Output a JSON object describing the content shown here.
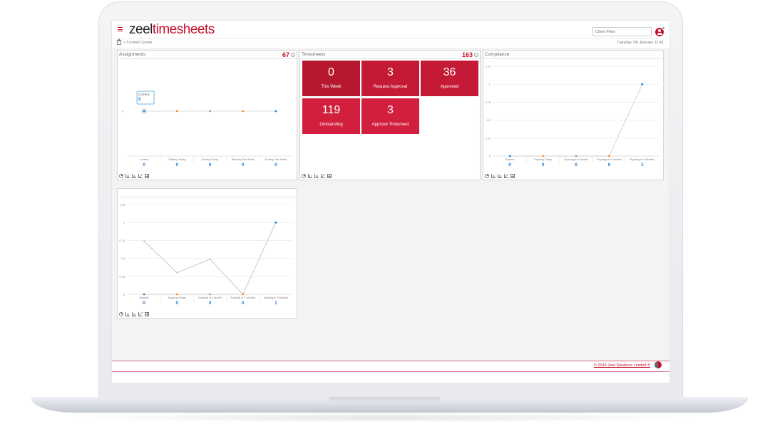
{
  "app": {
    "logo_part1": "zeel",
    "logo_part2": "timesheets",
    "client_filter_placeholder": "Client Filter",
    "breadcrumb": "» Control Centre",
    "datetime": "Tuesday 7th January 11:41",
    "copyright": "© 2016 Zeel Solutions Limited ®"
  },
  "colors": {
    "brand": "#c8102e",
    "tile_dark": "#b5182f",
    "tile": "#d11f3d",
    "blue": "#2a7bd0",
    "orange": "#f28c28"
  },
  "assignments": {
    "title": "Assignments",
    "count": "67",
    "tooltip_label": "Current",
    "tooltip_value": "0",
    "chart_data": {
      "type": "line",
      "categories": [
        "Current",
        "Starting Today",
        "Ending Today",
        "Starting This Week",
        "Ending This Week"
      ],
      "values": [
        0,
        0,
        0,
        0,
        0
      ],
      "point_colors": [
        "#2a7bd0",
        "#f28c28",
        "#999999",
        "#f28c28",
        "#2a7bd0"
      ],
      "ytick": "0",
      "value_labels": [
        "0",
        "0",
        "0",
        "0",
        "0"
      ]
    }
  },
  "timesheets": {
    "title": "Timesheets",
    "count": "163",
    "tiles": [
      {
        "value": "0",
        "label": "This Week"
      },
      {
        "value": "3",
        "label": "Request Approval"
      },
      {
        "value": "36",
        "label": "Approved"
      },
      {
        "value": "119",
        "label": "Outstanding"
      },
      {
        "value": "3",
        "label": "Approve Timesheet"
      }
    ]
  },
  "compliance": {
    "title": "Compliance",
    "chart_data": {
      "type": "line",
      "categories": [
        "Expired",
        "Expiring Today",
        "Expiring in 1 Month",
        "Expiring in 2 Months",
        "Expiring in 3 Months"
      ],
      "values": [
        0,
        0,
        0,
        0,
        1
      ],
      "ylim": [
        0,
        1.25
      ],
      "yticks": [
        "0",
        "0.25",
        "0.5",
        "0.75",
        "1",
        "1.25"
      ],
      "value_labels": [
        "0",
        "0",
        "0",
        "0",
        "1"
      ],
      "point_colors": [
        "#2a7bd0",
        "#f28c28",
        "#999999",
        "#f28c28",
        "#2a7bd0"
      ]
    }
  },
  "bottom_chart": {
    "title": "",
    "chart_data": {
      "type": "line",
      "categories": [
        "Expired",
        "Expiring Today",
        "Expiring in 1 Month",
        "Expiring in 2 Months",
        "Expiring in 3 Months"
      ],
      "values": [
        0,
        0,
        0,
        0,
        1
      ],
      "ylim": [
        0,
        1.25
      ],
      "yticks": [
        "0",
        "0.25",
        "0.5",
        "0.75",
        "1",
        "1.25"
      ],
      "value_labels": [
        "0",
        "0",
        "0",
        "0",
        "1"
      ],
      "extra_line": [
        0.74,
        0.3,
        0.49,
        0,
        1
      ],
      "point_colors": [
        "#2a7bd0",
        "#f28c28",
        "#999999",
        "#f28c28",
        "#2a7bd0"
      ]
    }
  }
}
